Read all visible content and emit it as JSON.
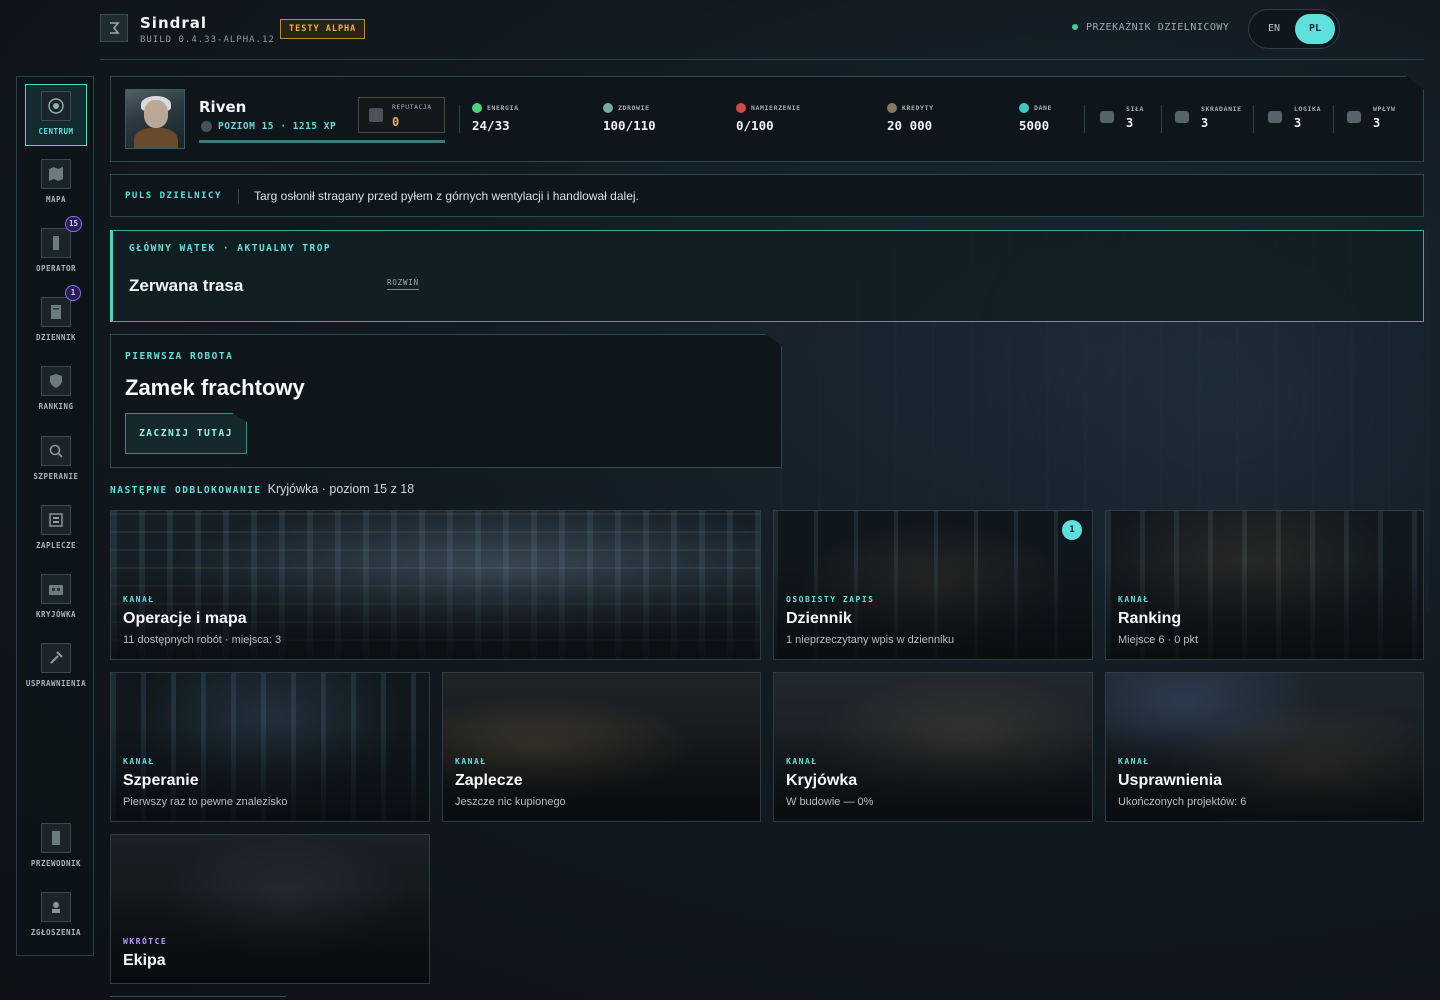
{
  "header": {
    "brand": "Sindral",
    "build": "BUILD 0.4.33-ALPHA.12",
    "alpha_badge": "TESTY ALPHA",
    "relay_status": "PRZEKAŹNIK DZIELNICOWY",
    "lang_en": "EN",
    "lang_pl": "PL"
  },
  "sidebar": {
    "items": [
      {
        "label": "CENTRUM",
        "icon": "target-icon",
        "active": true
      },
      {
        "label": "MAPA",
        "icon": "map-icon"
      },
      {
        "label": "OPERATOR",
        "icon": "phone-icon",
        "badge": "15"
      },
      {
        "label": "DZIENNIK",
        "icon": "journal-icon",
        "badge": "1"
      },
      {
        "label": "RANKING",
        "icon": "shield-icon"
      },
      {
        "label": "SZPERANIE",
        "icon": "search-icon"
      },
      {
        "label": "ZAPLECZE",
        "icon": "shop-icon"
      },
      {
        "label": "KRYJÓWKA",
        "icon": "hideout-icon"
      },
      {
        "label": "USPRAWNIENIA",
        "icon": "wrench-icon"
      }
    ],
    "bottom_items": [
      {
        "label": "PRZEWODNIK",
        "icon": "guide-icon"
      },
      {
        "label": "ZGŁOSZENIA",
        "icon": "report-icon"
      }
    ]
  },
  "player": {
    "name": "Riven",
    "level_text": "POZIOM 15 · 1215 XP",
    "xp_progress": 1.0,
    "reputation_label": "REPUTACJA",
    "reputation_value": "0",
    "stats": [
      {
        "label": "ENERGIA",
        "value": "24/33",
        "color": "#4fd07a"
      },
      {
        "label": "ZDROWIE",
        "value": "100/110",
        "color": "#7aa8a6"
      },
      {
        "label": "NAMIERZENIE",
        "value": "0/100",
        "color": "#d04a4a"
      },
      {
        "label": "KREDYTY",
        "value": "20 000",
        "color": "#8a7a5a"
      },
      {
        "label": "DANE",
        "value": "5000",
        "color": "#3ec8c0"
      }
    ],
    "attributes": [
      {
        "label": "SIŁA",
        "value": "3"
      },
      {
        "label": "SKRADANIE",
        "value": "3"
      },
      {
        "label": "LOGIKA",
        "value": "3"
      },
      {
        "label": "WPŁYW",
        "value": "3"
      }
    ]
  },
  "pulse": {
    "label": "PULS DZIELNICY",
    "text": "Targ osłonił stragany przed pyłem z górnych wentylacji i handlował dalej."
  },
  "quest": {
    "label": "GŁÓWNY WĄTEK · AKTUALNY TROP",
    "title": "Zerwana trasa",
    "expand": "ROZWIŃ"
  },
  "first_job": {
    "label": "PIERWSZA ROBOTA",
    "title": "Zamek frachtowy",
    "button": "ZACZNIJ TUTAJ"
  },
  "next_unlock": {
    "label": "NASTĘPNE ODBLOKOWANIE",
    "value": "Kryjówka · poziom 15 z 18"
  },
  "cards": [
    {
      "kicker": "KANAŁ",
      "title": "Operacje i mapa",
      "subtitle": "11 dostępnych robót · miejsca: 3"
    },
    {
      "kicker": "OSOBISTY ZAPIS",
      "title": "Dziennik",
      "subtitle": "1 nieprzeczytany wpis w dzienniku",
      "badge": "1"
    },
    {
      "kicker": "KANAŁ",
      "title": "Ranking",
      "subtitle": "Miejsce 6 · 0 pkt"
    },
    {
      "kicker": "KANAŁ",
      "title": "Szperanie",
      "subtitle": "Pierwszy raz to pewne znalezisko"
    },
    {
      "kicker": "KANAŁ",
      "title": "Zaplecze",
      "subtitle": "Jeszcze nic kupionego"
    },
    {
      "kicker": "KANAŁ",
      "title": "Kryjówka",
      "subtitle": "W budowie — 0%"
    },
    {
      "kicker": "KANAŁ",
      "title": "Usprawnienia",
      "subtitle": "Ukończonych projektów: 6"
    },
    {
      "kicker": "WKRÓTCE",
      "title": "Ekipa",
      "subtitle": ""
    }
  ],
  "colors": {
    "accent": "#5fe0dc",
    "alpha": "#e2b545",
    "soon": "#b79cff",
    "status_ok": "#3ecf8e"
  }
}
